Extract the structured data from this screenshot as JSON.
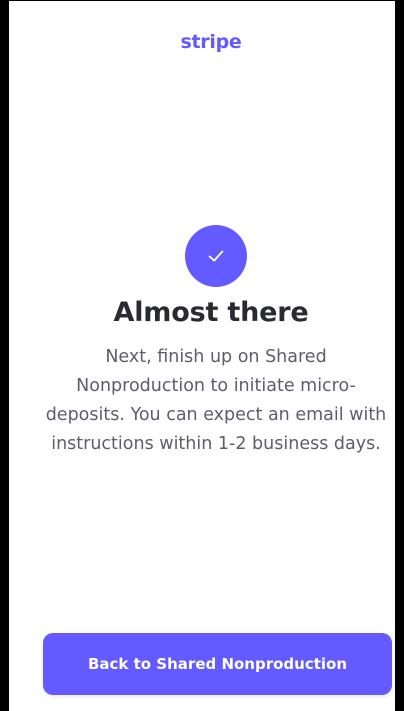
{
  "brand": {
    "logo_text": "stripe",
    "accent": "#635bff",
    "logo_color": "#635bff"
  },
  "main": {
    "icon": "checkmark-icon",
    "title": "Almost there",
    "message": "Next, finish up on Shared Nonproduction to initiate micro-deposits. You can expect an email with instructions within 1-2 business days."
  },
  "footer": {
    "button_label": "Back to Shared Nonproduction"
  }
}
